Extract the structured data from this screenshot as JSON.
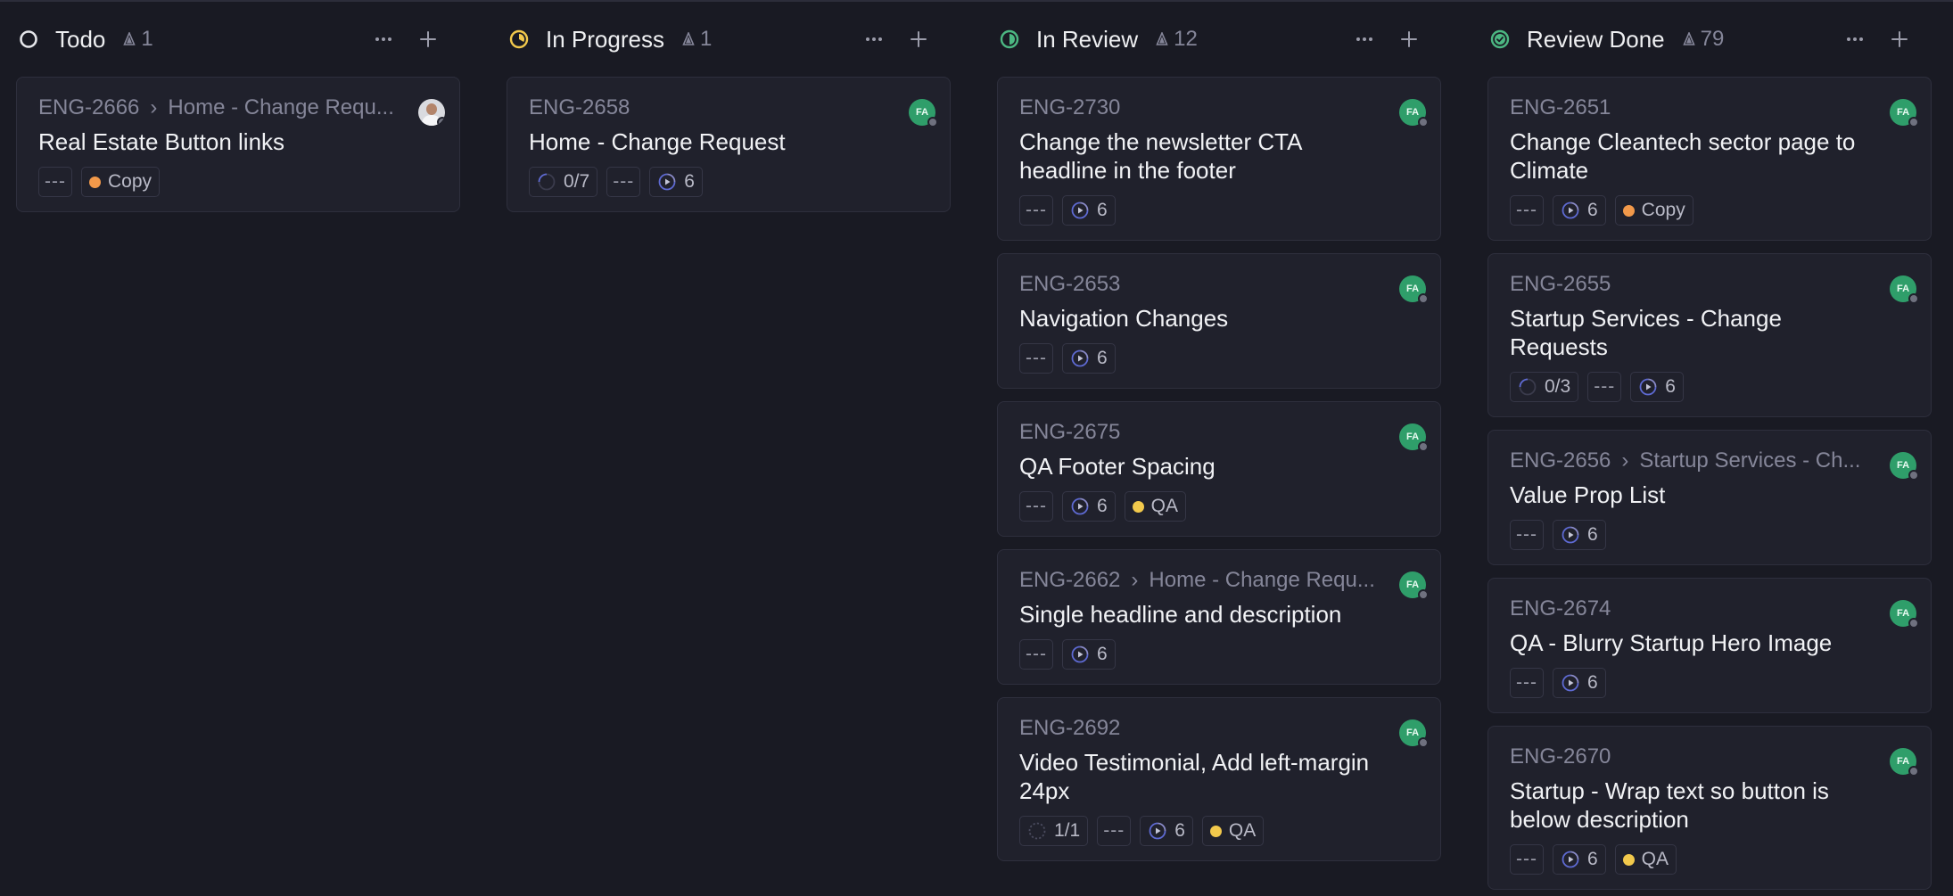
{
  "colors": {
    "todo": "#e5e6ea",
    "in_progress": "#f2c94c",
    "in_review": "#4cb782",
    "review_done": "#4cb782",
    "label_copy": "#f2994a",
    "label_qa": "#f2c94c",
    "avatar_bg": "#2f9e6a"
  },
  "columns": [
    {
      "title": "Todo",
      "count": "1",
      "status_icon": "todo-circle-icon",
      "cards": [
        {
          "id": "ENG-2666",
          "parent": "Home - Change Requ...",
          "title": "Real Estate Button links",
          "avatar": "photo",
          "chips": [
            {
              "type": "dashes",
              "text": "---"
            },
            {
              "type": "label",
              "text": "Copy",
              "color": "#f2994a"
            }
          ]
        }
      ]
    },
    {
      "title": "In Progress",
      "count": "1",
      "status_icon": "in-progress-icon",
      "cards": [
        {
          "id": "ENG-2658",
          "parent": "",
          "title": "Home - Change Request",
          "avatar": "FA",
          "chips": [
            {
              "type": "progress",
              "text": "0/7",
              "fill": 0
            },
            {
              "type": "dashes",
              "text": "---"
            },
            {
              "type": "cycle",
              "text": "6"
            }
          ]
        }
      ]
    },
    {
      "title": "In Review",
      "count": "12",
      "status_icon": "in-review-icon",
      "cards": [
        {
          "id": "ENG-2730",
          "parent": "",
          "title": "Change the newsletter CTA headline in the footer",
          "avatar": "FA",
          "chips": [
            {
              "type": "dashes",
              "text": "---"
            },
            {
              "type": "cycle",
              "text": "6"
            }
          ]
        },
        {
          "id": "ENG-2653",
          "parent": "",
          "title": "Navigation Changes",
          "avatar": "FA",
          "chips": [
            {
              "type": "dashes",
              "text": "---"
            },
            {
              "type": "cycle",
              "text": "6"
            }
          ]
        },
        {
          "id": "ENG-2675",
          "parent": "",
          "title": "QA Footer Spacing",
          "avatar": "FA",
          "chips": [
            {
              "type": "dashes",
              "text": "---"
            },
            {
              "type": "cycle",
              "text": "6"
            },
            {
              "type": "label",
              "text": "QA",
              "color": "#f2c94c"
            }
          ]
        },
        {
          "id": "ENG-2662",
          "parent": "Home - Change Requ...",
          "title": "Single headline and description",
          "avatar": "FA",
          "chips": [
            {
              "type": "dashes",
              "text": "---"
            },
            {
              "type": "cycle",
              "text": "6"
            }
          ]
        },
        {
          "id": "ENG-2692",
          "parent": "",
          "title": "Video Testimonial, Add left-margin 24px",
          "avatar": "FA",
          "chips": [
            {
              "type": "progress",
              "text": "1/1",
              "fill": 1
            },
            {
              "type": "dashes",
              "text": "---"
            },
            {
              "type": "cycle",
              "text": "6"
            },
            {
              "type": "label",
              "text": "QA",
              "color": "#f2c94c"
            }
          ]
        }
      ]
    },
    {
      "title": "Review Done",
      "count": "79",
      "status_icon": "review-done-icon",
      "cards": [
        {
          "id": "ENG-2651",
          "parent": "",
          "title": "Change Cleantech sector page to Climate",
          "avatar": "FA",
          "chips": [
            {
              "type": "dashes",
              "text": "---"
            },
            {
              "type": "cycle",
              "text": "6"
            },
            {
              "type": "label",
              "text": "Copy",
              "color": "#f2994a"
            }
          ]
        },
        {
          "id": "ENG-2655",
          "parent": "",
          "title": "Startup Services - Change Requests",
          "avatar": "FA",
          "chips": [
            {
              "type": "progress",
              "text": "0/3",
              "fill": 0
            },
            {
              "type": "dashes",
              "text": "---"
            },
            {
              "type": "cycle",
              "text": "6"
            }
          ]
        },
        {
          "id": "ENG-2656",
          "parent": "Startup Services - Ch...",
          "title": "Value Prop List",
          "avatar": "FA",
          "chips": [
            {
              "type": "dashes",
              "text": "---"
            },
            {
              "type": "cycle",
              "text": "6"
            }
          ]
        },
        {
          "id": "ENG-2674",
          "parent": "",
          "title": "QA - Blurry Startup Hero Image",
          "avatar": "FA",
          "chips": [
            {
              "type": "dashes",
              "text": "---"
            },
            {
              "type": "cycle",
              "text": "6"
            }
          ]
        },
        {
          "id": "ENG-2670",
          "parent": "",
          "title": "Startup - Wrap text so button is below description",
          "avatar": "FA",
          "chips": [
            {
              "type": "dashes",
              "text": "---"
            },
            {
              "type": "cycle",
              "text": "6"
            },
            {
              "type": "label",
              "text": "QA",
              "color": "#f2c94c"
            }
          ]
        }
      ]
    }
  ]
}
